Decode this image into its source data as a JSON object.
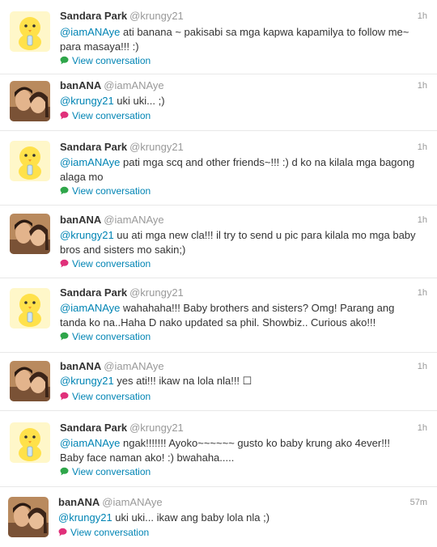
{
  "colors": {
    "link": "#0084b4",
    "name": "#333333",
    "meta": "#999999",
    "conv_icon_green": "#2fa64a",
    "conv_icon_pink": "#e0307a",
    "divider": "#e8e8e8"
  },
  "icons": {
    "sandara_avatar": "yellow-chick-avatar",
    "banana_avatar": "couple-photo-avatar",
    "conversation": "speech-bubble-icon"
  },
  "tweets": [
    {
      "name": "Sandara Park",
      "handle": "@krungy21",
      "time": "1h",
      "mention": "@iamANAye",
      "text": " ati banana ~ pakisabi sa mga kapwa kapamilya to follow me~ para masaya!!! :)",
      "conv_label": "View conversation"
    },
    {
      "name": "banANA",
      "handle": "@iamANAye",
      "time": "1h",
      "mention": "@krungy21",
      "text": " uki uki... ;)",
      "conv_label": "View conversation"
    },
    {
      "name": "Sandara Park",
      "handle": "@krungy21",
      "time": "1h",
      "mention": "@iamANAye",
      "text": " pati mga scq and other friends~!!! :) d ko na kilala mga bagong alaga mo",
      "conv_label": "View conversation"
    },
    {
      "name": "banANA",
      "handle": "@iamANAye",
      "time": "1h",
      "mention": "@krungy21",
      "text": " uu ati mga new cla!!! il try to send u pic para kilala mo mga baby bros and sisters mo sakin;)",
      "conv_label": "View conversation"
    },
    {
      "name": "Sandara Park",
      "handle": "@krungy21",
      "time": "1h",
      "mention": "@iamANAye",
      "text": " wahahaha!!! Baby brothers and sisters? Omg! Parang ang tanda ko na..Haha D nako updated sa phil. Showbiz.. Curious ako!!!",
      "conv_label": "View conversation"
    },
    {
      "name": "banANA",
      "handle": "@iamANAye",
      "time": "1h",
      "mention": "@krungy21",
      "text": " yes ati!!! ikaw na lola nla!!! ☐",
      "conv_label": "View conversation"
    },
    {
      "name": "Sandara Park",
      "handle": "@krungy21",
      "time": "1h",
      "mention": "@iamANAye",
      "text": " ngak!!!!!!! Ayoko~~~~~~ gusto ko baby krung ako 4ever!!! Baby face naman ako! :) bwahaha.....",
      "conv_label": "View conversation"
    },
    {
      "name": "banANA",
      "handle": "@iamANAye",
      "time": "57m",
      "mention": "@krungy21",
      "text": " uki uki... ikaw ang baby lola nla ;)",
      "conv_label": "View conversation"
    }
  ]
}
